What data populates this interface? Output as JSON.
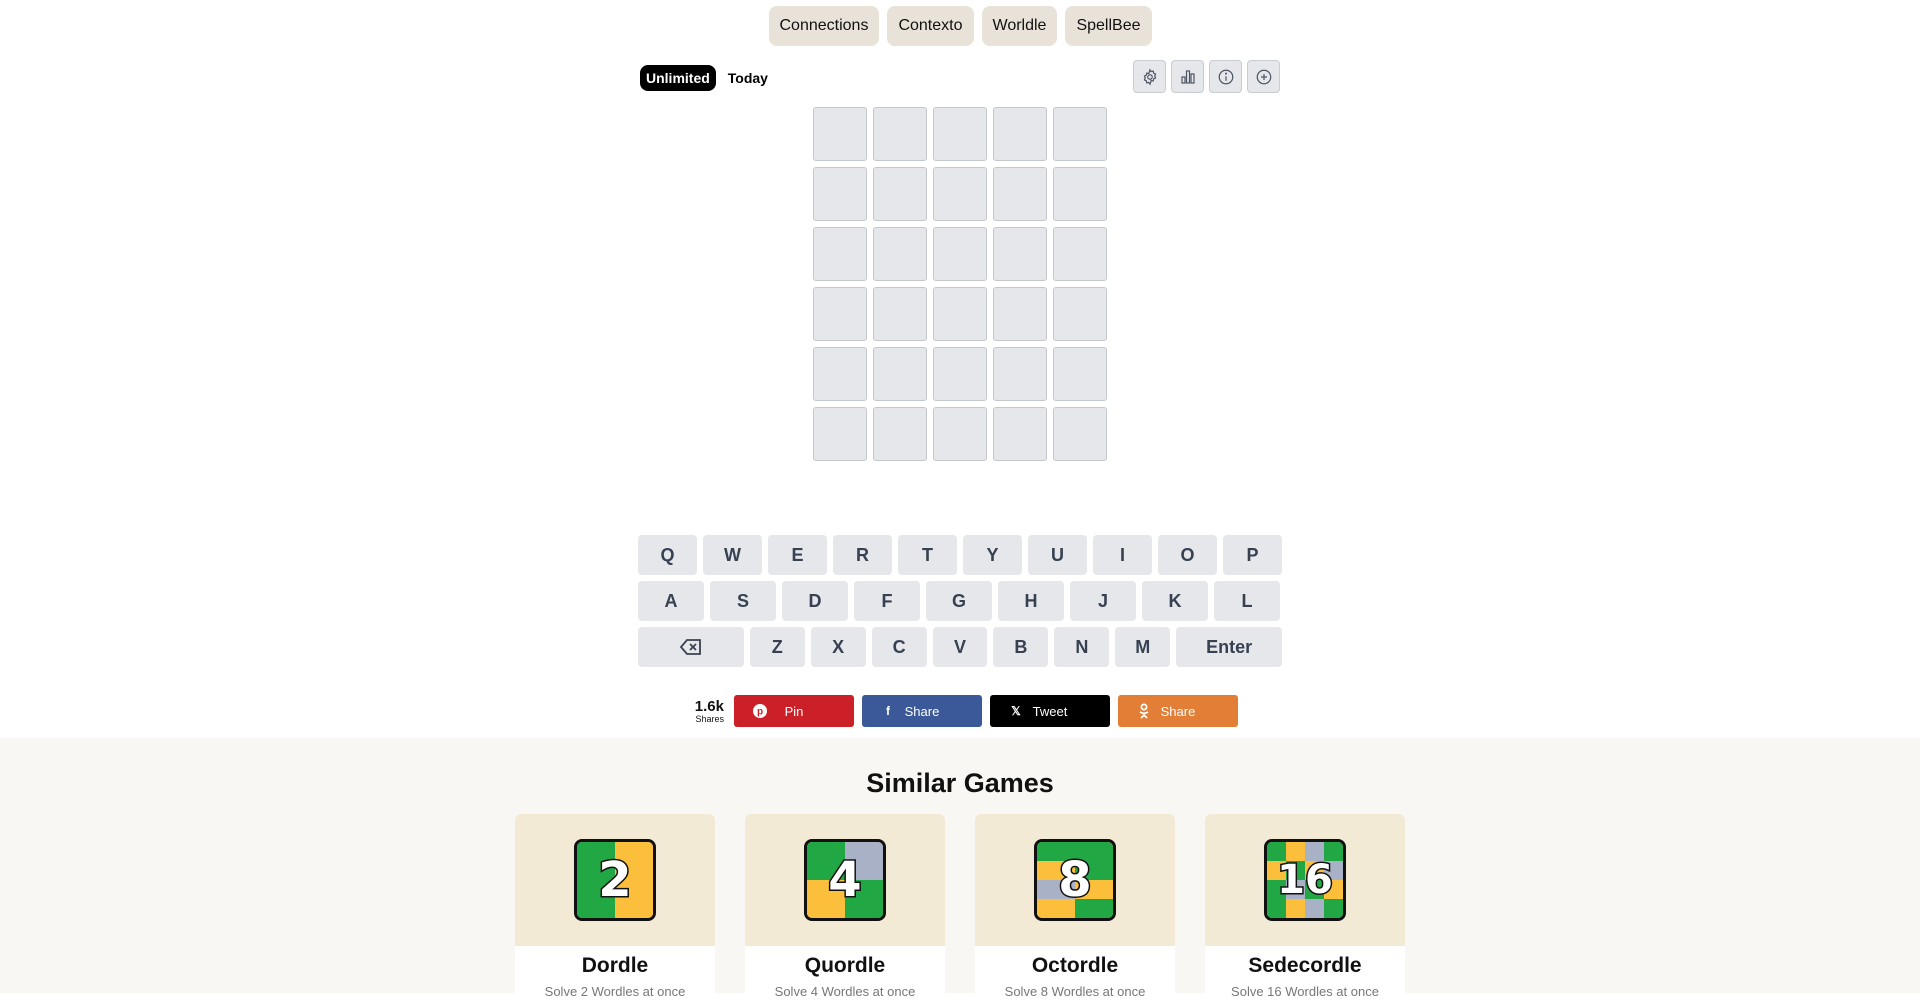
{
  "nav": [
    "Connections",
    "Contexto",
    "Worldle",
    "SpellBee"
  ],
  "modes": {
    "active": "Unlimited",
    "inactive": "Today"
  },
  "tools": [
    "gear-icon",
    "bar-chart-icon",
    "info-icon",
    "plus-circle-icon"
  ],
  "board": {
    "rows": 6,
    "cols": 5
  },
  "keyboard": {
    "row1": [
      "Q",
      "W",
      "E",
      "R",
      "T",
      "Y",
      "U",
      "I",
      "O",
      "P"
    ],
    "row2": [
      "A",
      "S",
      "D",
      "F",
      "G",
      "H",
      "J",
      "K",
      "L"
    ],
    "row3": [
      "Z",
      "X",
      "C",
      "V",
      "B",
      "N",
      "M"
    ],
    "enter": "Enter",
    "backspace_icon": "backspace-icon"
  },
  "share": {
    "count": "1.6k",
    "count_label": "Shares",
    "buttons": [
      {
        "label": "Pin",
        "icon": "pinterest-icon",
        "color": "#cb2027"
      },
      {
        "label": "Share",
        "icon": "facebook-icon",
        "color": "#3b5998"
      },
      {
        "label": "Tweet",
        "icon": "x-icon",
        "color": "#000000"
      },
      {
        "label": "Share",
        "icon": "odnoklassniki-icon",
        "color": "#e27e35"
      }
    ]
  },
  "similar": {
    "heading": "Similar Games",
    "games": [
      {
        "name": "Dordle",
        "desc": "Solve 2 Wordles at once",
        "badge": "2"
      },
      {
        "name": "Quordle",
        "desc": "Solve 4 Wordles at once",
        "badge": "4"
      },
      {
        "name": "Octordle",
        "desc": "Solve 8 Wordles at once",
        "badge": "8"
      },
      {
        "name": "Sedecordle",
        "desc": "Solve 16 Wordles at once",
        "badge": "16"
      }
    ]
  },
  "colors": {
    "green": "#22a745",
    "yellow": "#fbbf3c",
    "gray": "#a9b1c6"
  }
}
